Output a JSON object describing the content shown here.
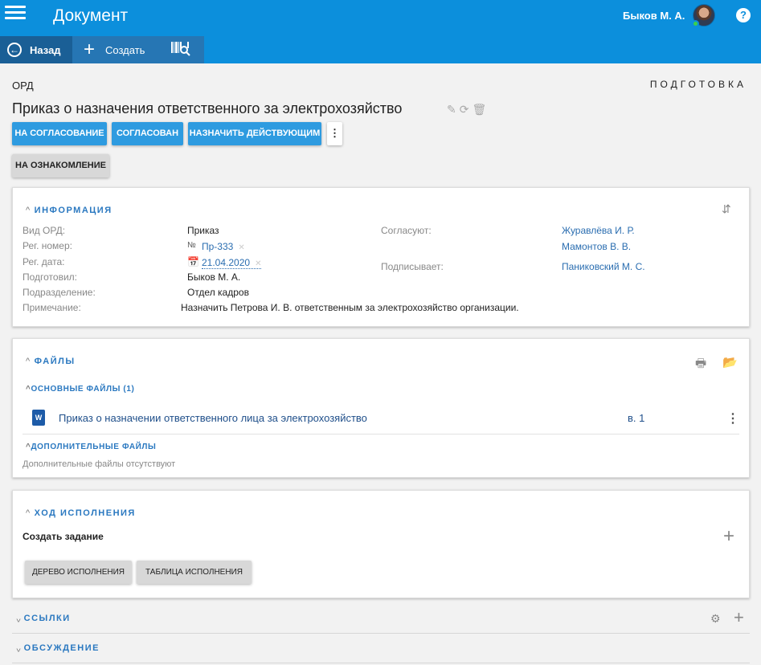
{
  "header": {
    "title": "Документ",
    "user_name": "Быков М. А.",
    "help_label": "?"
  },
  "toolbar": {
    "back_label": "Назад",
    "create_label": "Создать"
  },
  "document": {
    "type": "ОРД",
    "status": "ПОДГОТОВКА",
    "title": "Приказ о назначения ответственного за электрохозяйство"
  },
  "actions": {
    "to_approval": "На согласование",
    "approved": "Согласован",
    "make_active": "Назначить действующим",
    "to_review": "На ознакомление"
  },
  "info": {
    "heading": "ИНФОРМАЦИЯ",
    "fields": {
      "ord_type_label": "Вид ОРД:",
      "ord_type_value": "Приказ",
      "reg_number_label": "Рег. номер:",
      "reg_number_prefix": "№",
      "reg_number_value": "Пр-333",
      "reg_date_label": "Рег. дата:",
      "reg_date_value": "21.04.2020",
      "prepared_label": "Подготовил:",
      "prepared_value": "Быков М. А.",
      "department_label": "Подразделение:",
      "department_value": "Отдел кадров",
      "note_label": "Примечание:",
      "note_value": "Назначить Петрова И. В. ответственным за электрохозяйство организации.",
      "approvers_label": "Согласуют:",
      "approvers": [
        "Журавлёва И. Р.",
        "Мамонтов В. В."
      ],
      "signer_label": "Подписывает:",
      "signer_value": "Паниковский М. С."
    }
  },
  "files": {
    "heading": "ФАЙЛЫ",
    "main_heading": "ОСНОВНЫЕ ФАЙЛЫ (1)",
    "main_files": [
      {
        "name": "Приказ о назначении ответственного лица за электрохозяйство",
        "version": "в. 1",
        "icon": "W"
      }
    ],
    "extra_heading": "ДОПОЛНИТЕЛЬНЫЕ ФАЙЛЫ",
    "extra_empty": "Дополнительные файлы отсутствуют"
  },
  "execution": {
    "heading": "ХОД ИСПОЛНЕНИЯ",
    "create_task": "Создать задание",
    "tree_button": "Дерево исполнения",
    "table_button": "Таблица исполнения"
  },
  "links": {
    "heading": "ССЫЛКИ"
  },
  "discussion": {
    "heading": "ОБСУЖДЕНИЕ"
  },
  "colors": {
    "primary": "#0c8fdc",
    "toolbar_dark": "#1a5f96",
    "button_blue": "#2e9be0",
    "link": "#2a6db0",
    "online": "#3bd14a"
  }
}
